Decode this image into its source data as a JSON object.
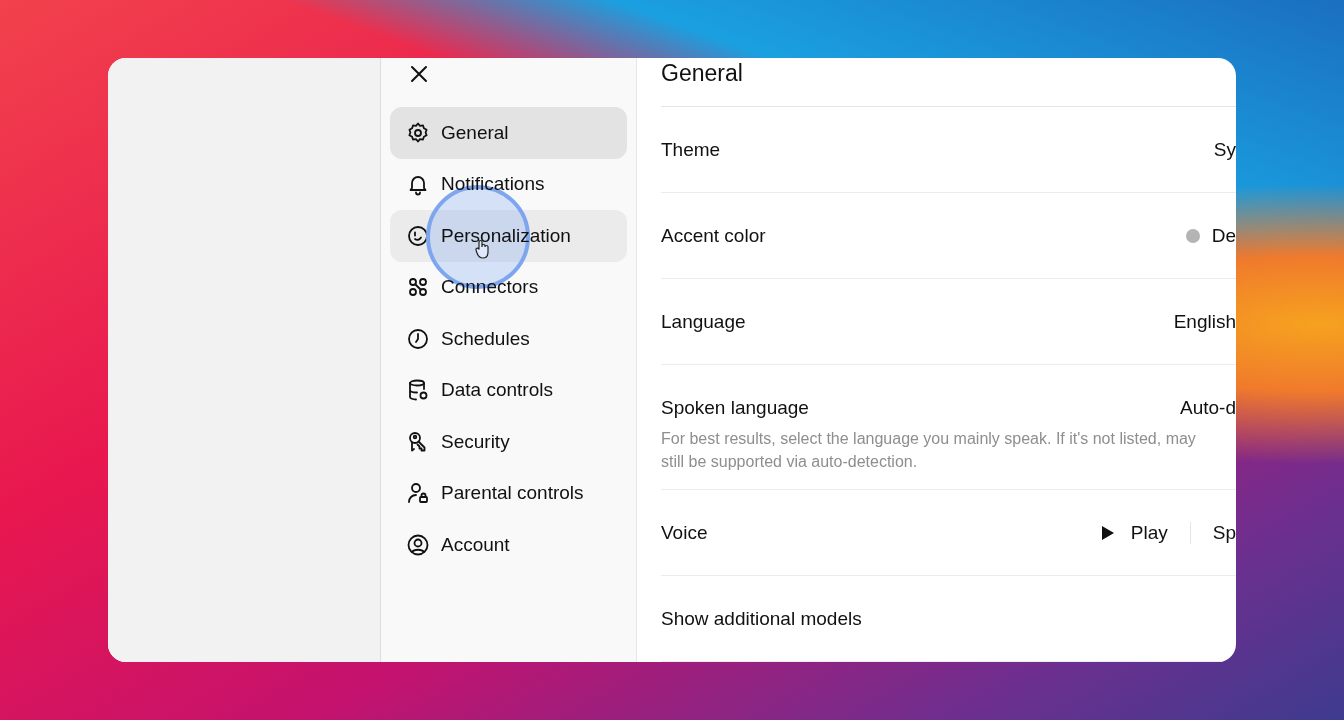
{
  "sidebar": {
    "items": [
      {
        "label": "General",
        "selected": true,
        "hovered": false
      },
      {
        "label": "Notifications",
        "selected": false,
        "hovered": false
      },
      {
        "label": "Personalization",
        "selected": false,
        "hovered": true
      },
      {
        "label": "Connectors",
        "selected": false,
        "hovered": false
      },
      {
        "label": "Schedules",
        "selected": false,
        "hovered": false
      },
      {
        "label": "Data controls",
        "selected": false,
        "hovered": false
      },
      {
        "label": "Security",
        "selected": false,
        "hovered": false
      },
      {
        "label": "Parental controls",
        "selected": false,
        "hovered": false
      },
      {
        "label": "Account",
        "selected": false,
        "hovered": false
      }
    ]
  },
  "content": {
    "title": "General",
    "rows": [
      {
        "kind": "value",
        "label": "Theme",
        "value": "Sy"
      },
      {
        "kind": "dot",
        "label": "Accent color",
        "value": "De"
      },
      {
        "kind": "value",
        "label": "Language",
        "value": "English"
      },
      {
        "kind": "value",
        "label": "Spoken language",
        "value": "Auto-d",
        "description": "For best results, select the language you mainly speak. If it's not listed, may still be supported via auto-detection."
      },
      {
        "kind": "voice",
        "label": "Voice",
        "play": "Play",
        "value": "Sp"
      },
      {
        "kind": "value",
        "label": "Show additional models"
      }
    ]
  }
}
